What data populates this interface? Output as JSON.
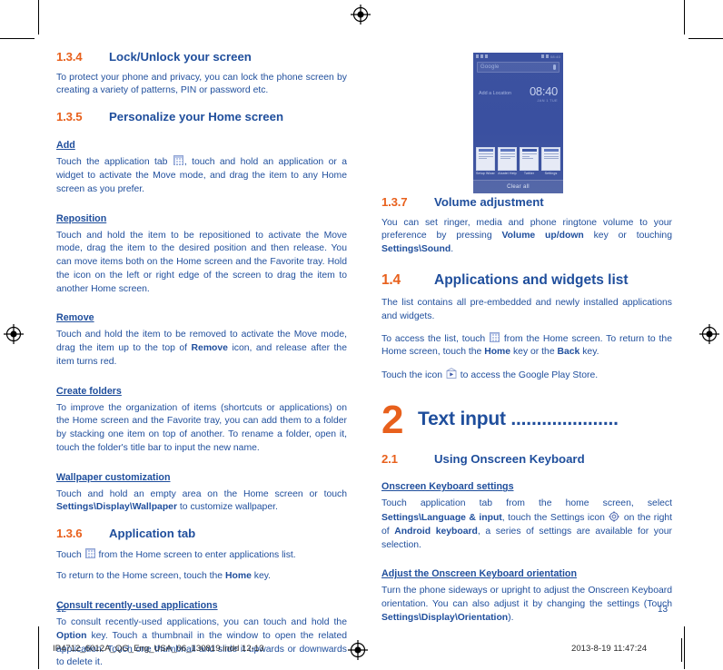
{
  "document": {
    "left_page_number": "12",
    "right_page_number": "13",
    "print_filename": "IP4712_6012A_QG_Eng_USA_06_130819.indd   12-13",
    "print_timestamp": "2013-8-19   11:47:24"
  },
  "colors": {
    "accent_orange": "#E8601C",
    "body_navy": "#1F4E9C",
    "phone_overlay": "#3c52a0"
  },
  "left_page": {
    "sections": [
      {
        "number": "1.3.4",
        "title": "Lock/Unlock your screen",
        "body": "To protect your phone and privacy, you can lock the phone screen by creating a variety of patterns, PIN or password etc."
      },
      {
        "number": "1.3.5",
        "title": "Personalize your Home screen"
      }
    ],
    "add_heading": "Add",
    "add_body_1": "Touch the application tab",
    "add_body_2": ", touch and hold an application or a widget to activate the Move mode, and drag the item to any Home screen as you prefer.",
    "reposition_heading": "Reposition",
    "reposition_body": "Touch and hold the item to be repositioned to activate the Move mode, drag the item to the desired position and then release. You can move items both on the Home screen and the Favorite tray. Hold the icon on the left or right edge of the screen to drag the item to another Home screen.",
    "remove_heading": "Remove",
    "remove_body_1": "Touch and hold the item to be removed to activate the Move mode, drag the item up to the top of ",
    "remove_body_bold": "Remove",
    "remove_body_2": " icon, and release after the item turns red.",
    "create_folders_heading": "Create folders",
    "create_folders_body": "To improve the organization of items (shortcuts or applications) on the Home screen and the Favorite tray, you can add them to a folder by stacking one item on top of another. To rename a folder, open it, touch the folder's title bar to input the new name.",
    "wallpaper_heading": "Wallpaper customization",
    "wallpaper_body_1": "Touch and hold an empty area on the Home screen or touch ",
    "wallpaper_body_bold": "Settings\\Display\\Wallpaper",
    "wallpaper_body_2": " to customize wallpaper.",
    "apptab_section": {
      "number": "1.3.6",
      "title": "Application tab"
    },
    "apptab_body_1": "Touch",
    "apptab_body_2": "from the Home screen to enter applications list.",
    "apptab_return_1": "To return to the Home screen, touch the ",
    "apptab_return_bold": "Home",
    "apptab_return_2": " key.",
    "consult_heading": "Consult recently-used applications",
    "consult_body_1": "To consult recently-used applications, you can touch and hold the ",
    "consult_body_bold": "Option",
    "consult_body_2": " key. Touch a thumbnail in the window to open the related application. Touch one thumbnail and slide it upwards or downwards to delete it."
  },
  "phone_screenshot": {
    "status_time": "08:40",
    "search_placeholder": "Google",
    "widget_location": "Add a Location",
    "widget_time": "08:40",
    "widget_date": "JAN 1 TUE",
    "recent_apps": [
      {
        "label": "Setup Wizard"
      },
      {
        "label": "Alcatel Help"
      },
      {
        "label": "Twitter"
      },
      {
        "label": "Settings"
      }
    ],
    "clear_all_label": "Clear all"
  },
  "right_page": {
    "volume_section": {
      "number": "1.3.7",
      "title": "Volume adjustment"
    },
    "volume_body_1": "You can set ringer, media and phone ringtone volume to your preference by pressing ",
    "volume_body_bold_1": "Volume up/down",
    "volume_body_2": " key or touching ",
    "volume_body_bold_2": "Settings\\Sound",
    "volume_body_3": ".",
    "apps_section": {
      "number": "1.4",
      "title": "Applications and widgets list"
    },
    "apps_body": "The list contains all pre-embedded and newly installed applications and widgets.",
    "access_body_1": "To access the list, touch",
    "access_body_2": "from the Home screen. To return to the Home screen, touch the ",
    "access_bold_1": "Home",
    "access_body_3": " key or the ",
    "access_bold_2": "Back",
    "access_body_4": " key.",
    "play_body_1": "Touch the icon",
    "play_body_2": "to access the Google Play Store.",
    "chapter": {
      "number": "2",
      "title": "Text input ....................."
    },
    "keyboard_section": {
      "number": "2.1",
      "title": "Using Onscreen Keyboard"
    },
    "settings_heading": "Onscreen Keyboard settings",
    "settings_body_1": "Touch application tab from the home screen, select ",
    "settings_bold_1": "Settings\\Language & input",
    "settings_body_2": ", touch the Settings icon",
    "settings_body_3": "on the right of ",
    "settings_bold_2": "Android keyboard",
    "settings_body_4": ", a series of settings are available for your selection.",
    "orientation_heading": "Adjust the Onscreen Keyboard orientation",
    "orientation_body_1": "Turn the phone sideways or upright to adjust the Onscreen Keyboard orientation. You can also adjust it by changing the settings (Touch ",
    "orientation_bold": "Settings\\Display\\Orientation",
    "orientation_body_2": ")."
  }
}
